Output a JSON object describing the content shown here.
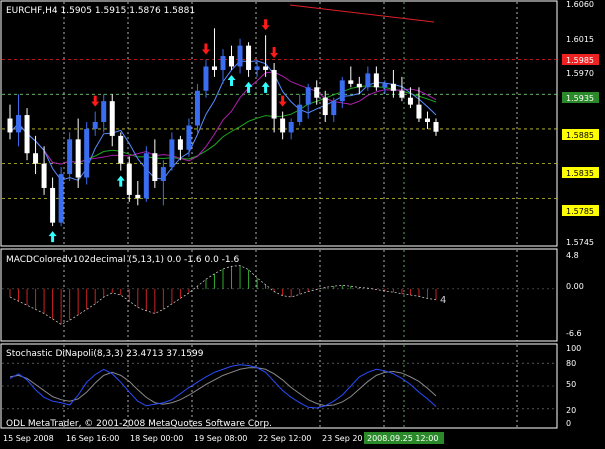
{
  "window": {
    "symbol_caption": "EURCHF,H4  1.5905 1.5915 1.5876 1.5881"
  },
  "colors": {
    "background": "#000000",
    "frame": "#ffffff",
    "bull": "#3b6df0",
    "bear": "#ffffff",
    "ma_green": "#1fa81f",
    "ma_purple": "#b01fb0",
    "ma_blue": "#5a8cff",
    "trend_red": "#e0202a",
    "arrow_down": "#ff1a1a",
    "arrow_up": "#33ffff",
    "grid_yellow": "#cccc33",
    "grid_green": "#88ee88",
    "grid_red": "#ee2222",
    "macd_green": "#2ea82e",
    "macd_red": "#cc2222",
    "stoch_main": "#2a4cff",
    "stoch_signal": "#888888",
    "current_tag": "#2a8a2a"
  },
  "price_axis": {
    "ticks": [
      "1.6060",
      "1.6015",
      "1.5970",
      "1.5745"
    ],
    "level_tags": [
      {
        "label": "1.5935",
        "bg": "#2a8a2a",
        "fg": "#ffffff"
      },
      {
        "label": "1.5885",
        "bg": "#ffff00",
        "fg": "#000000"
      },
      {
        "label": "1.5835",
        "bg": "#ffff00",
        "fg": "#000000"
      },
      {
        "label": "1.5785",
        "bg": "#ffff00",
        "fg": "#000000"
      },
      {
        "label": "1.5985",
        "bg": "#ee2222",
        "fg": "#ffffff"
      }
    ]
  },
  "macd": {
    "caption": "MACDColoredv102decimal (5,13,1) 0.0 -1.6 0.0 -1.6",
    "ticks": [
      "4.8",
      "0.00",
      "-6.6"
    ],
    "end_label": "4"
  },
  "stochastic": {
    "caption": "Stochastic DiNapoli(8,3,3) 23.4713 37.1599",
    "ticks": [
      "100",
      "80",
      "50",
      "20",
      "0"
    ]
  },
  "copyright": "ODL MetaTrader, © 2001-2008 MetaQuotes Software Corp.",
  "time_axis": {
    "labels": [
      "15 Sep 2008",
      "16 Sep 16:00",
      "18 Sep 00:00",
      "19 Sep 08:00",
      "22 Sep 12:00",
      "23 Sep 20",
      "2008.09.25 12:00"
    ]
  },
  "chart_data": [
    {
      "type": "candlestick",
      "title": "EURCHF,H4",
      "ylim": [
        1.5725,
        1.6065
      ],
      "candles": [
        [
          1.59,
          1.592,
          1.587,
          1.588
        ],
        [
          1.588,
          1.5935,
          1.586,
          1.5905
        ],
        [
          1.5905,
          1.5915,
          1.584,
          1.585
        ],
        [
          1.585,
          1.5875,
          1.582,
          1.5835
        ],
        [
          1.5835,
          1.586,
          1.579,
          1.58
        ],
        [
          1.58,
          1.5815,
          1.5745,
          1.575
        ],
        [
          1.575,
          1.583,
          1.5745,
          1.582
        ],
        [
          1.582,
          1.588,
          1.581,
          1.587
        ],
        [
          1.587,
          1.59,
          1.58,
          1.5815
        ],
        [
          1.5815,
          1.5895,
          1.5805,
          1.5885
        ],
        [
          1.5885,
          1.591,
          1.5875,
          1.5895
        ],
        [
          1.5895,
          1.5935,
          1.588,
          1.5925
        ],
        [
          1.5925,
          1.5935,
          1.586,
          1.5875
        ],
        [
          1.5875,
          1.588,
          1.5825,
          1.5835
        ],
        [
          1.5835,
          1.5845,
          1.578,
          1.579
        ],
        [
          1.579,
          1.581,
          1.5775,
          1.5785
        ],
        [
          1.5785,
          1.586,
          1.578,
          1.585
        ],
        [
          1.585,
          1.587,
          1.58,
          1.581
        ],
        [
          1.581,
          1.584,
          1.5775,
          1.583
        ],
        [
          1.583,
          1.588,
          1.5825,
          1.587
        ],
        [
          1.587,
          1.5875,
          1.584,
          1.5855
        ],
        [
          1.5855,
          1.59,
          1.5845,
          1.589
        ],
        [
          1.589,
          1.595,
          1.588,
          1.594
        ],
        [
          1.594,
          1.5985,
          1.593,
          1.5975
        ],
        [
          1.5975,
          1.603,
          1.596,
          1.597
        ],
        [
          1.597,
          1.6,
          1.595,
          1.599
        ],
        [
          1.599,
          1.6005,
          1.597,
          1.5975
        ],
        [
          1.5975,
          1.6015,
          1.5965,
          1.6005
        ],
        [
          1.6005,
          1.601,
          1.596,
          1.597
        ],
        [
          1.597,
          1.5985,
          1.596,
          1.5975
        ],
        [
          1.5975,
          1.602,
          1.596,
          1.597
        ],
        [
          1.597,
          1.598,
          1.588,
          1.59
        ],
        [
          1.59,
          1.591,
          1.587,
          1.588
        ],
        [
          1.588,
          1.59,
          1.587,
          1.5895
        ],
        [
          1.5895,
          1.5935,
          1.589,
          1.592
        ],
        [
          1.592,
          1.595,
          1.59,
          1.5945
        ],
        [
          1.5945,
          1.5955,
          1.592,
          1.593
        ],
        [
          1.593,
          1.594,
          1.5895,
          1.5905
        ],
        [
          1.5905,
          1.593,
          1.5895,
          1.5925
        ],
        [
          1.5925,
          1.596,
          1.5915,
          1.5955
        ],
        [
          1.5955,
          1.5975,
          1.5945,
          1.595
        ],
        [
          1.595,
          1.596,
          1.5935,
          1.5945
        ],
        [
          1.5945,
          1.5975,
          1.594,
          1.5965
        ],
        [
          1.5965,
          1.5975,
          1.594,
          1.5945
        ],
        [
          1.5945,
          1.5955,
          1.5935,
          1.595
        ],
        [
          1.595,
          1.597,
          1.593,
          1.594
        ],
        [
          1.594,
          1.596,
          1.5925,
          1.593
        ],
        [
          1.593,
          1.5945,
          1.5915,
          1.592
        ],
        [
          1.592,
          1.5945,
          1.5895,
          1.59
        ],
        [
          1.59,
          1.591,
          1.5885,
          1.5895
        ],
        [
          1.5895,
          1.59,
          1.5875,
          1.5881
        ]
      ],
      "arrows_down": [
        10,
        23,
        30,
        31,
        32
      ],
      "arrows_up": [
        5,
        13,
        26,
        28,
        30
      ],
      "levels": [
        1.5935,
        1.5885,
        1.5835,
        1.5785,
        1.5985
      ]
    },
    {
      "type": "histogram",
      "title": "MACDColoredv102decimal (5,13,1)",
      "ylim": [
        -6.6,
        4.8
      ],
      "values": [
        -1.2,
        -1.8,
        -2.4,
        -3.0,
        -3.6,
        -4.4,
        -5.2,
        -4.6,
        -3.8,
        -3.0,
        -2.2,
        -1.2,
        -0.6,
        -0.9,
        -1.8,
        -2.7,
        -3.2,
        -3.6,
        -3.0,
        -2.2,
        -1.4,
        -0.6,
        0.4,
        1.4,
        2.2,
        2.9,
        3.3,
        3.4,
        2.8,
        1.6,
        0.6,
        -0.4,
        -1.0,
        -1.2,
        -0.8,
        -0.4,
        -0.1,
        0.2,
        0.4,
        0.5,
        0.4,
        0.2,
        0.1,
        -0.1,
        -0.3,
        -0.5,
        -0.7,
        -0.9,
        -1.1,
        -1.4,
        -1.6
      ]
    },
    {
      "type": "line",
      "title": "Stochastic DiNapoli(8,3,3)",
      "ylim": [
        0,
        100
      ],
      "series": [
        {
          "values": [
            60,
            66,
            58,
            45,
            35,
            30,
            28,
            25,
            38,
            55,
            65,
            72,
            66,
            55,
            42,
            30,
            24,
            26,
            28,
            32,
            40,
            48,
            55,
            62,
            68,
            72,
            76,
            78,
            77,
            74,
            68,
            56,
            44,
            35,
            28,
            22,
            21,
            24,
            30,
            38,
            50,
            62,
            68,
            72,
            70,
            66,
            60,
            52,
            42,
            33,
            23
          ]
        },
        {
          "values": [
            62,
            64,
            60,
            52,
            44,
            36,
            32,
            30,
            33,
            42,
            54,
            64,
            68,
            64,
            56,
            45,
            35,
            28,
            26,
            28,
            32,
            38,
            45,
            52,
            58,
            64,
            68,
            72,
            74,
            74,
            72,
            66,
            58,
            48,
            40,
            32,
            27,
            24,
            25,
            29,
            36,
            46,
            56,
            64,
            68,
            69,
            67,
            62,
            56,
            47,
            37
          ]
        }
      ]
    }
  ]
}
